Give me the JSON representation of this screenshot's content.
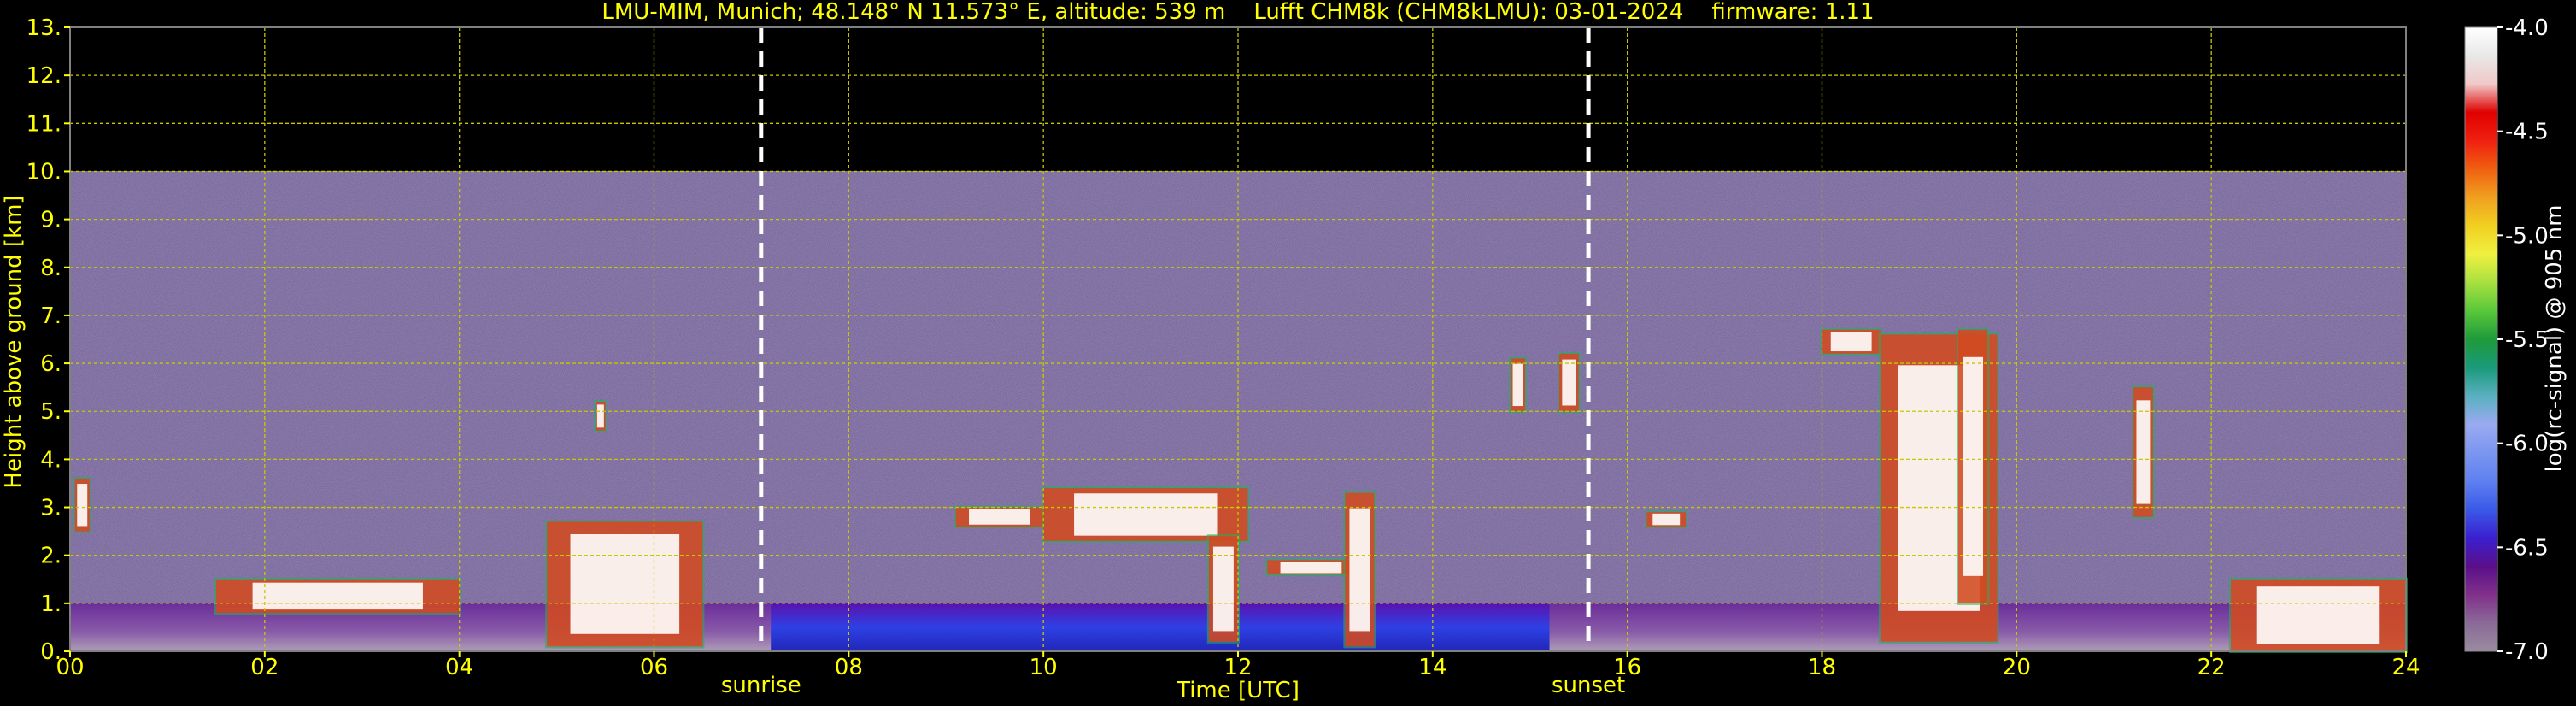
{
  "chart_data": {
    "type": "heatmap",
    "title": "LMU-MIM, Munich; 48.148° N 11.573° E, altitude: 539 m    Lufft CHM8k (CHM8kLMU): 03-01-2024    firmware: 1.11",
    "xlabel": "Time [UTC]",
    "ylabel": "Height above ground [km]",
    "xlim": [
      0,
      24
    ],
    "ylim": [
      0,
      13
    ],
    "x_ticks": [
      "00",
      "02",
      "04",
      "06",
      "08",
      "10",
      "12",
      "14",
      "16",
      "18",
      "20",
      "22",
      "24"
    ],
    "y_ticks": [
      "0.",
      "1.",
      "2.",
      "3.",
      "4.",
      "5.",
      "6.",
      "7.",
      "8.",
      "9.",
      "10.",
      "11.",
      "12.",
      "13."
    ],
    "grid": true,
    "data_top_km": 10,
    "markers": [
      {
        "label": "sunrise",
        "time": 7.1
      },
      {
        "label": "sunset",
        "time": 15.6
      }
    ],
    "colorbar": {
      "label": "log(rc-signal) @ 905 nm",
      "range": [
        -7.0,
        -4.0
      ],
      "ticks": [
        "-4.0",
        "-4.5",
        "-5.0",
        "-5.5",
        "-6.0",
        "-6.5",
        "-7.0"
      ],
      "colors": [
        "#9a8ca0",
        "#8a6a98",
        "#80308a",
        "#5a0f8a",
        "#3a20d0",
        "#3a5ae8",
        "#5f80f0",
        "#7a96f0",
        "#9aaaf0",
        "#5ab0c0",
        "#1a9a7a",
        "#1f9a3a",
        "#58c83a",
        "#a8e040",
        "#f0f040",
        "#f0d020",
        "#f0a020",
        "#f06010",
        "#f02010",
        "#e00000",
        "#f0c8c8",
        "#e8e8e8",
        "#ffffff"
      ]
    },
    "features": [
      {
        "kind": "boundary_layer",
        "start": 0,
        "end": 24,
        "top_km": 1.0,
        "color": "#8a6a98"
      },
      {
        "kind": "aerosol_dense",
        "start": 7.2,
        "end": 15.2,
        "top_km": 1.0,
        "color": "#3a30e0"
      },
      {
        "kind": "cloud",
        "start": 0.05,
        "end": 0.2,
        "base_km": 2.5,
        "top_km": 3.6
      },
      {
        "kind": "cloud",
        "start": 1.5,
        "end": 4.0,
        "base_km": 0.8,
        "top_km": 1.5
      },
      {
        "kind": "cloud",
        "start": 5.4,
        "end": 5.5,
        "base_km": 4.6,
        "top_km": 5.2
      },
      {
        "kind": "cloud",
        "start": 4.9,
        "end": 6.5,
        "base_km": 0.1,
        "top_km": 2.7
      },
      {
        "kind": "cloud",
        "start": 9.1,
        "end": 10.0,
        "base_km": 2.6,
        "top_km": 3.0
      },
      {
        "kind": "cloud",
        "start": 10.0,
        "end": 12.1,
        "base_km": 2.3,
        "top_km": 3.4
      },
      {
        "kind": "cloud",
        "start": 11.7,
        "end": 12.0,
        "base_km": 0.2,
        "top_km": 2.4
      },
      {
        "kind": "cloud",
        "start": 12.3,
        "end": 13.2,
        "base_km": 1.6,
        "top_km": 1.9
      },
      {
        "kind": "cloud",
        "start": 13.1,
        "end": 13.4,
        "base_km": 0.1,
        "top_km": 3.3
      },
      {
        "kind": "cloud",
        "start": 14.8,
        "end": 14.95,
        "base_km": 5.0,
        "top_km": 6.1
      },
      {
        "kind": "cloud",
        "start": 15.3,
        "end": 15.5,
        "base_km": 5.0,
        "top_km": 6.2
      },
      {
        "kind": "cloud",
        "start": 16.2,
        "end": 16.6,
        "base_km": 2.6,
        "top_km": 2.9
      },
      {
        "kind": "cloud",
        "start": 18.0,
        "end": 18.6,
        "base_km": 6.2,
        "top_km": 6.7
      },
      {
        "kind": "cloud",
        "start": 18.6,
        "end": 19.8,
        "base_km": 0.2,
        "top_km": 6.6
      },
      {
        "kind": "cloud",
        "start": 19.4,
        "end": 19.7,
        "base_km": 1.0,
        "top_km": 6.7
      },
      {
        "kind": "cloud",
        "start": 21.2,
        "end": 21.4,
        "base_km": 2.8,
        "top_km": 5.5
      },
      {
        "kind": "cloud",
        "start": 22.2,
        "end": 24.0,
        "base_km": 0.0,
        "top_km": 1.5
      }
    ]
  }
}
